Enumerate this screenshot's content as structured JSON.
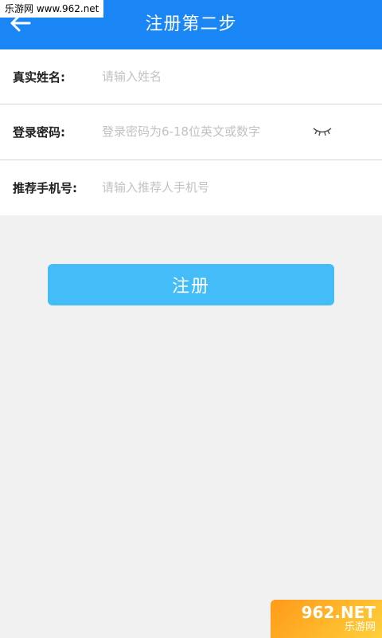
{
  "watermark": {
    "top_text": "乐游网 www.962.net",
    "bottom_big": "962.NET",
    "bottom_small": "乐游网"
  },
  "header": {
    "title": "注册第二步",
    "back_icon": "arrow-left-icon"
  },
  "form": {
    "name": {
      "label": "真实姓名:",
      "placeholder": "请输入姓名",
      "value": ""
    },
    "password": {
      "label": "登录密码:",
      "placeholder": "登录密码为6-18位英文或数字",
      "value": "",
      "toggle_icon": "eye-closed-icon"
    },
    "referrer": {
      "label": "推荐手机号:",
      "placeholder": "请输入推荐人手机号",
      "value": ""
    }
  },
  "submit": {
    "label": "注册"
  },
  "colors": {
    "header_bg": "#1a86f5",
    "button_bg": "#44bcf7",
    "page_bg": "#f1f1f1"
  }
}
